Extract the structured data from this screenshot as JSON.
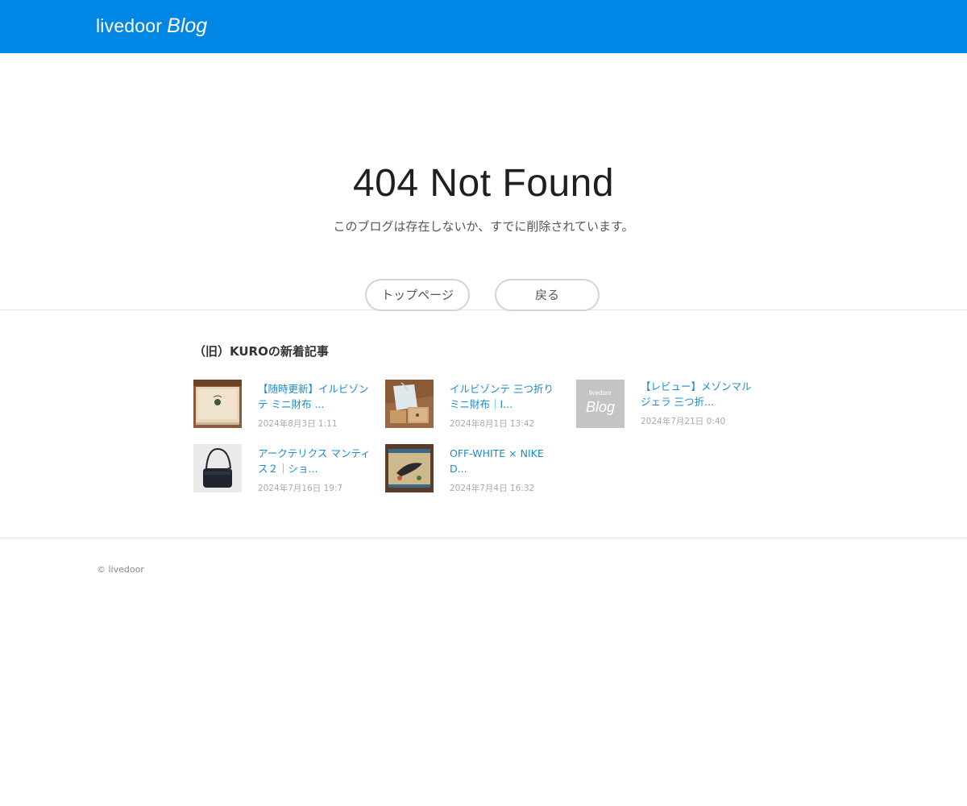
{
  "header": {
    "logo_text": "livedoor",
    "logo_suffix": "Blog",
    "bg_color": "#0087e6"
  },
  "hero": {
    "title": "404 Not Found",
    "message": "このブログは存在しないか、すでに削除されています。",
    "buttons": {
      "top_page": "トップページ",
      "back": "戻る"
    }
  },
  "recent": {
    "heading": "（旧）KUROの新着記事",
    "articles": [
      {
        "title": "【随時更新】イルビゾンテ ミニ財布 ...",
        "date": "2024年8月3日 1:11",
        "thumb": "wallet-box-photo"
      },
      {
        "title": "イルビゾンテ 三つ折りミニ財布｜I...",
        "date": "2024年8月1日 13:42",
        "thumb": "wallet-bag-photo"
      },
      {
        "title": "【レビュー】メゾンマルジェラ 三つ折...",
        "date": "2024年7月21日 0:40",
        "thumb": "livedoor-blog-placeholder",
        "thumb_text_top": "livedoor",
        "thumb_text_bottom": "Blog"
      },
      {
        "title": "アークテリクス マンティス２｜ショ...",
        "date": "2024年7月16日 19:7",
        "thumb": "shoulder-bag-photo"
      },
      {
        "title": "OFF-WHITE × NIKE D...",
        "date": "2024年7月4日 16:32",
        "thumb": "sneaker-box-photo"
      }
    ]
  },
  "footer": {
    "copyright": "© livedoor"
  }
}
